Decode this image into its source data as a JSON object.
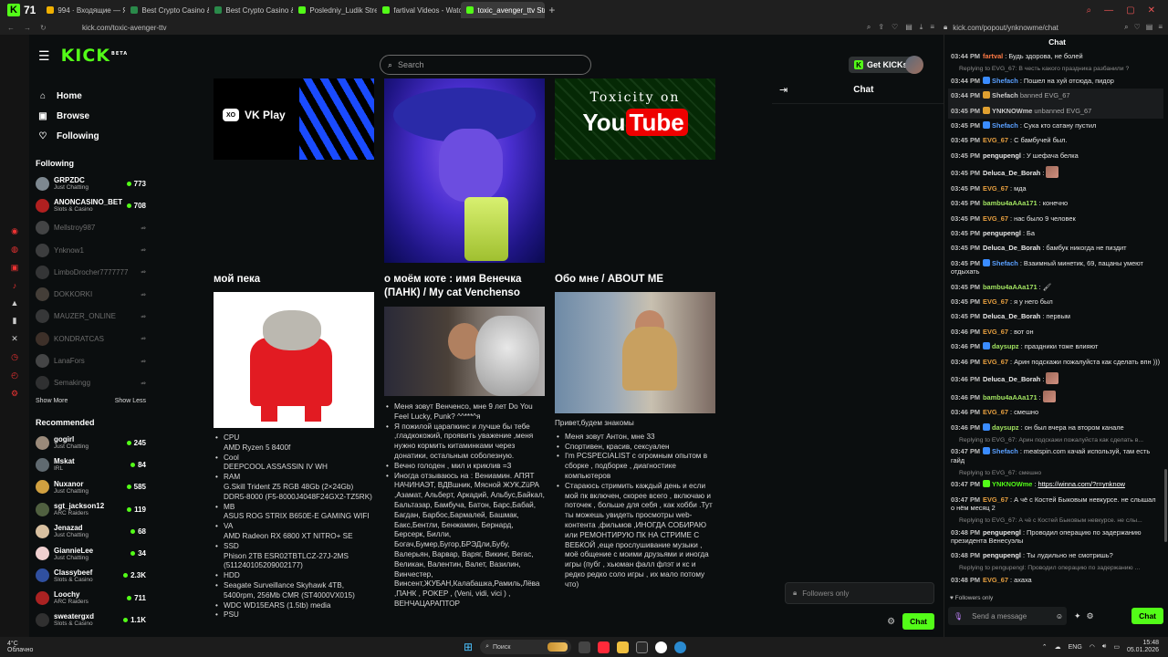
{
  "browser": {
    "tab_count": "71",
    "tabs": [
      {
        "label": "994 · Входящие — Яндекс",
        "color": "#f0b000"
      },
      {
        "label": "Best Crypto Casino & Bitc",
        "color": "#2a8a4a"
      },
      {
        "label": "Best Crypto Casino & Bitc",
        "color": "#2a8a4a"
      },
      {
        "label": "Posledniy_Ludik Stream -",
        "color": "#53fc18"
      },
      {
        "label": "fartival Videos - Watch Or",
        "color": "#53fc18"
      },
      {
        "label": "toxic_avenger_ttv Strea",
        "color": "#53fc18",
        "active": true
      }
    ],
    "url": "kick.com/toxic-avenger-ttv",
    "popout_url": "kick.com/popout/ynknowme/chat"
  },
  "kick": {
    "logo": "KICK",
    "logo_sup": "BETA",
    "search_placeholder": "Search",
    "get_kicks": "Get KICKs",
    "nav": [
      {
        "icon": "⌂",
        "label": "Home"
      },
      {
        "icon": "▣",
        "label": "Browse"
      },
      {
        "icon": "♡",
        "label": "Following"
      }
    ],
    "following_title": "Following",
    "following": [
      {
        "name": "GRPZDC",
        "cat": "Just Chatting",
        "viewers": "773",
        "live": true,
        "color": "#7d8890"
      },
      {
        "name": "ANONCASINO_BET",
        "cat": "Slots & Casino",
        "viewers": "708",
        "live": true,
        "color": "#b02020"
      },
      {
        "name": "Mellstroy987",
        "cat": "",
        "viewers": "⇏",
        "live": false,
        "color": "#888"
      },
      {
        "name": "Ynknow1",
        "cat": "",
        "viewers": "⇏",
        "live": false,
        "color": "#777"
      },
      {
        "name": "LimboDrocher7777777",
        "cat": "",
        "viewers": "⇏",
        "live": false,
        "color": "#666"
      },
      {
        "name": "DOKKORKI",
        "cat": "",
        "viewers": "⇏",
        "live": false,
        "color": "#8a7a6a"
      },
      {
        "name": "MAUZER_ONLINE",
        "cat": "",
        "viewers": "⇏",
        "live": false,
        "color": "#6a6a6a"
      },
      {
        "name": "KONDRATCAS",
        "cat": "",
        "viewers": "⇏",
        "live": false,
        "color": "#7a5a4a"
      },
      {
        "name": "LanaFors",
        "cat": "",
        "viewers": "⇏",
        "live": false,
        "color": "#8a8a8a"
      },
      {
        "name": "Semakingg",
        "cat": "",
        "viewers": "⇏",
        "live": false,
        "color": "#5a5a5a"
      }
    ],
    "show_more": "Show More",
    "show_less": "Show Less",
    "recommended_title": "Recommended",
    "recommended": [
      {
        "name": "gogirl",
        "cat": "Just Chatting",
        "viewers": "245",
        "color": "#9a8a7a"
      },
      {
        "name": "Mskat",
        "cat": "IRL",
        "viewers": "84",
        "color": "#606a70"
      },
      {
        "name": "Nuxanor",
        "cat": "Just Chatting",
        "viewers": "585",
        "color": "#d0a040"
      },
      {
        "name": "sgt_jackson12",
        "cat": "ARC Raiders",
        "viewers": "119",
        "color": "#506040"
      },
      {
        "name": "Jenazad",
        "cat": "Just Chatting",
        "viewers": "68",
        "color": "#d8c0a0"
      },
      {
        "name": "GiannieLee",
        "cat": "Just Chatting",
        "viewers": "34",
        "color": "#f0d0d0"
      },
      {
        "name": "Classybeef",
        "cat": "Slots & Casino",
        "viewers": "2.3K",
        "color": "#3050a0"
      },
      {
        "name": "Loochy",
        "cat": "ARC Raiders",
        "viewers": "711",
        "color": "#aa2222"
      },
      {
        "name": "sweatergxd",
        "cat": "Slots & Casino",
        "viewers": "1.1K",
        "color": "#303030"
      }
    ]
  },
  "panels": {
    "vk_play": "VK Play",
    "yt_line1": "Toxicity on",
    "yt_you": "You",
    "yt_tube": "Tube",
    "cat_title": "мой пека",
    "venchenso_title": "о моём коте : имя Венечка (ПАНК) / My cat Venchenso",
    "about_title": "Обо мне / ABOUT ME",
    "pc_specs": [
      {
        "label": "CPU",
        "value": "AMD Ryzen 5 8400f"
      },
      {
        "label": "Cool",
        "value": "DEEPCOOL ASSASSIN IV WH"
      },
      {
        "label": "RAM",
        "value": "G.Skill Trident Z5 RGB 48Gb (2×24Gb) DDR5-8000 (F5-8000J4048F24GX2-TZ5RK)"
      },
      {
        "label": "MB",
        "value": "ASUS ROG STRIX B650E-E GAMING WIFI"
      },
      {
        "label": "VA",
        "value": "AMD Radeon RX 6800 XT NITRO+ SE"
      },
      {
        "label": "SSD",
        "value": "Phison 2TB ESR02TBTLCZ-27J-2MS (511240105209002177)"
      },
      {
        "label": "HDD",
        "value": ""
      },
      {
        "label": "",
        "value": "Seagate Surveillance Skyhawk 4TB, 5400rpm, 256Mb CMR (ST4000VX015)"
      },
      {
        "label": "",
        "value": "WDC WD15EARS (1.5tb) media"
      },
      {
        "label": "PSU",
        "value": ""
      }
    ],
    "cat_bullets": [
      "Меня зовут Венченсо, мне 9 лет Do You Feel Lucky, Punk? ^^***^я",
      "Я пожилой царапкинс и лучше бы тебе ,гладкокожий, проявить уважение ,меня нужно кормить китаминками через донатики, остальным соболезную.",
      "Вечно голоден , мил и криклив =3",
      "Иногда отзываюсь на : Вениамин. АПЯТ НАЧИНАЭТ, ВДВшник, Мясной ЖУК,ZüPA ,Азамат, Альберт, Аркадий, Альбус,Байкал, Бальтазар, Бамбуча, Батон, Барс,Бабай, Багдан, Барбос,Бармалей, Башмак, Бакс,Бентли, Бенжамин, Бернард, Берсерк, Билли, Богач,Бумер,Бугор,БРЭДли,Бубу, Валерьян, Варвар, Варяг, Викинг, Вегас, Великан, Валентин, Валет, Вазилин, Винчестер, Винсент,ЖУБАН,Калабашка,Рамиль,Лёва ,ПАНК , POKEP , (Veni, vidi, vici ) , ВЕНЧАЦАРАПТОР"
    ],
    "about_intro": "Привет,будем знакомы",
    "about_bullets": [
      "Меня зовут Антон, мне 33",
      "Спортивен, красив, сексуален",
      "I'm PCSPECIALIST с огромным опытом в сборке , подборке , диагностике компьютеров",
      "Стараюсь стримить каждый день и если мой пк включен, скорее всего , включаю и поточек , больше для себя , как хобби .Тут ты можешь увидеть просмотры web-контента ,фильмов ,ИНОГДА СОБИРАЮ или РЕМОНТИРУЮ ПК НА СТРИМЕ С ВЕБКОЙ ,еще прослушивание музыки , моё общение с моими друзьями и иногда игры (пубг , хьюман фалл флэт и кс и редко редко соло игры , их мало потому что)"
    ]
  },
  "embedded_chat": {
    "title": "Chat",
    "followers_only": "Followers only",
    "chat_button": "Chat"
  },
  "popout": {
    "title": "Chat",
    "messages": [
      {
        "time": "03:44 PM",
        "user": "fartval",
        "color": "#ff7a45",
        "text": "Будь здорова, не болей"
      },
      {
        "reply": "Replying to EVG_67: В честь какого праздника разбанили ?"
      },
      {
        "time": "03:44 PM",
        "user": "Shefach",
        "color": "#5aa0ff",
        "badge": "#3a8cff",
        "text": "Пошел на хуй отсюда, пидор"
      },
      {
        "time": "03:44 PM",
        "user": "Shefach",
        "color": "#ccc",
        "badge": "#e0a030",
        "text": "banned EVG_67",
        "mod": true
      },
      {
        "time": "03:45 PM",
        "user": "YNKNOWme",
        "color": "#ccc",
        "badge": "#e0a030",
        "text": "unbanned EVG_67",
        "mod": true
      },
      {
        "time": "03:45 PM",
        "user": "Shefach",
        "color": "#5aa0ff",
        "badge": "#3a8cff",
        "text": "Сука кто сатану пустил"
      },
      {
        "time": "03:45 PM",
        "user": "EVG_67",
        "color": "#e8a040",
        "text": "С бамбучей был."
      },
      {
        "time": "03:45 PM",
        "user": "pengupengl",
        "color": "#e8e8e8",
        "text": "У шефача белка"
      },
      {
        "time": "03:45 PM",
        "user": "Deluca_De_Borah",
        "color": "#e8e8e8",
        "text": "",
        "emote": true
      },
      {
        "time": "03:45 PM",
        "user": "EVG_67",
        "color": "#e8a040",
        "text": "мда"
      },
      {
        "time": "03:45 PM",
        "user": "bambu4aAAa171",
        "color": "#a0e060",
        "text": "конечно"
      },
      {
        "time": "03:45 PM",
        "user": "EVG_67",
        "color": "#e8a040",
        "text": "нас было 9 человек"
      },
      {
        "time": "03:45 PM",
        "user": "pengupengl",
        "color": "#e8e8e8",
        "text": "Ба"
      },
      {
        "time": "03:45 PM",
        "user": "Deluca_De_Borah",
        "color": "#e8e8e8",
        "text": "бамбук никогда не пиздит"
      },
      {
        "time": "03:45 PM",
        "user": "Shefach",
        "color": "#5aa0ff",
        "badge": "#3a8cff",
        "text": "Взаимный минетик, 69, пацаны умеют отдыхать"
      },
      {
        "time": "03:45 PM",
        "user": "bambu4aAAa171",
        "color": "#a0e060",
        "text": "🖌"
      },
      {
        "time": "03:45 PM",
        "user": "EVG_67",
        "color": "#e8a040",
        "text": "я у него был"
      },
      {
        "time": "03:45 PM",
        "user": "Deluca_De_Borah",
        "color": "#e8e8e8",
        "text": "первым"
      },
      {
        "time": "03:46 PM",
        "user": "EVG_67",
        "color": "#e8a040",
        "text": "вот он"
      },
      {
        "time": "03:46 PM",
        "user": "daysupz",
        "color": "#a0e060",
        "badge": "#3a8cff",
        "text": "праздники тоже влияют"
      },
      {
        "time": "03:46 PM",
        "user": "EVG_67",
        "color": "#e8a040",
        "text": "Арин подскажи пожалуйста как сделать впн )))"
      },
      {
        "time": "03:46 PM",
        "user": "Deluca_De_Borah",
        "color": "#e8e8e8",
        "text": "",
        "emote": true
      },
      {
        "time": "03:46 PM",
        "user": "bambu4aAAa171",
        "color": "#a0e060",
        "text": "",
        "emote": true
      },
      {
        "time": "03:46 PM",
        "user": "EVG_67",
        "color": "#e8a040",
        "text": "смешно"
      },
      {
        "time": "03:46 PM",
        "user": "daysupz",
        "color": "#a0e060",
        "badge": "#3a8cff",
        "text": "он был вчера на втором канале"
      },
      {
        "reply": "Replying to EVG_67: Арин подскажи пожалуйста как сделать в..."
      },
      {
        "time": "03:47 PM",
        "user": "Shefach",
        "color": "#5aa0ff",
        "badge": "#3a8cff",
        "text": "meatspin.com качай используй, там есть гайд"
      },
      {
        "reply": "Replying to EVG_67: смешно"
      },
      {
        "time": "03:47 PM",
        "user": "YNKNOWme",
        "color": "#53fc18",
        "badge": "#53fc18",
        "text": "",
        "link": "https://winna.com/?r=ynknow"
      },
      {
        "time": "03:47 PM",
        "user": "EVG_67",
        "color": "#e8a040",
        "text": "А чё с Костей Быковым невкурсе. не слышал о нём месяц 2"
      },
      {
        "reply": "Replying to EVG_67: А чё с Костей Быковым невкурсе. не слы..."
      },
      {
        "time": "03:48 PM",
        "user": "pengupengl",
        "color": "#e8e8e8",
        "text": "Проводил операцию по задержанию президента Венесуэлы"
      },
      {
        "time": "03:48 PM",
        "user": "pengupengl",
        "color": "#e8e8e8",
        "text": "Ты лудильно не смотришь?"
      },
      {
        "reply": "Replying to pengupengl: Проводил операцию по задержанию ..."
      },
      {
        "time": "03:48 PM",
        "user": "EVG_67",
        "color": "#e8a040",
        "text": "ахаха"
      }
    ],
    "followers_only": "Followers only",
    "input_placeholder": "Send a message",
    "chat_button": "Chat"
  },
  "taskbar": {
    "temp": "4°C",
    "weather": "Облачно",
    "search": "Поиск",
    "lang": "ENG",
    "time": "15:48",
    "date": "05.01.2026"
  }
}
